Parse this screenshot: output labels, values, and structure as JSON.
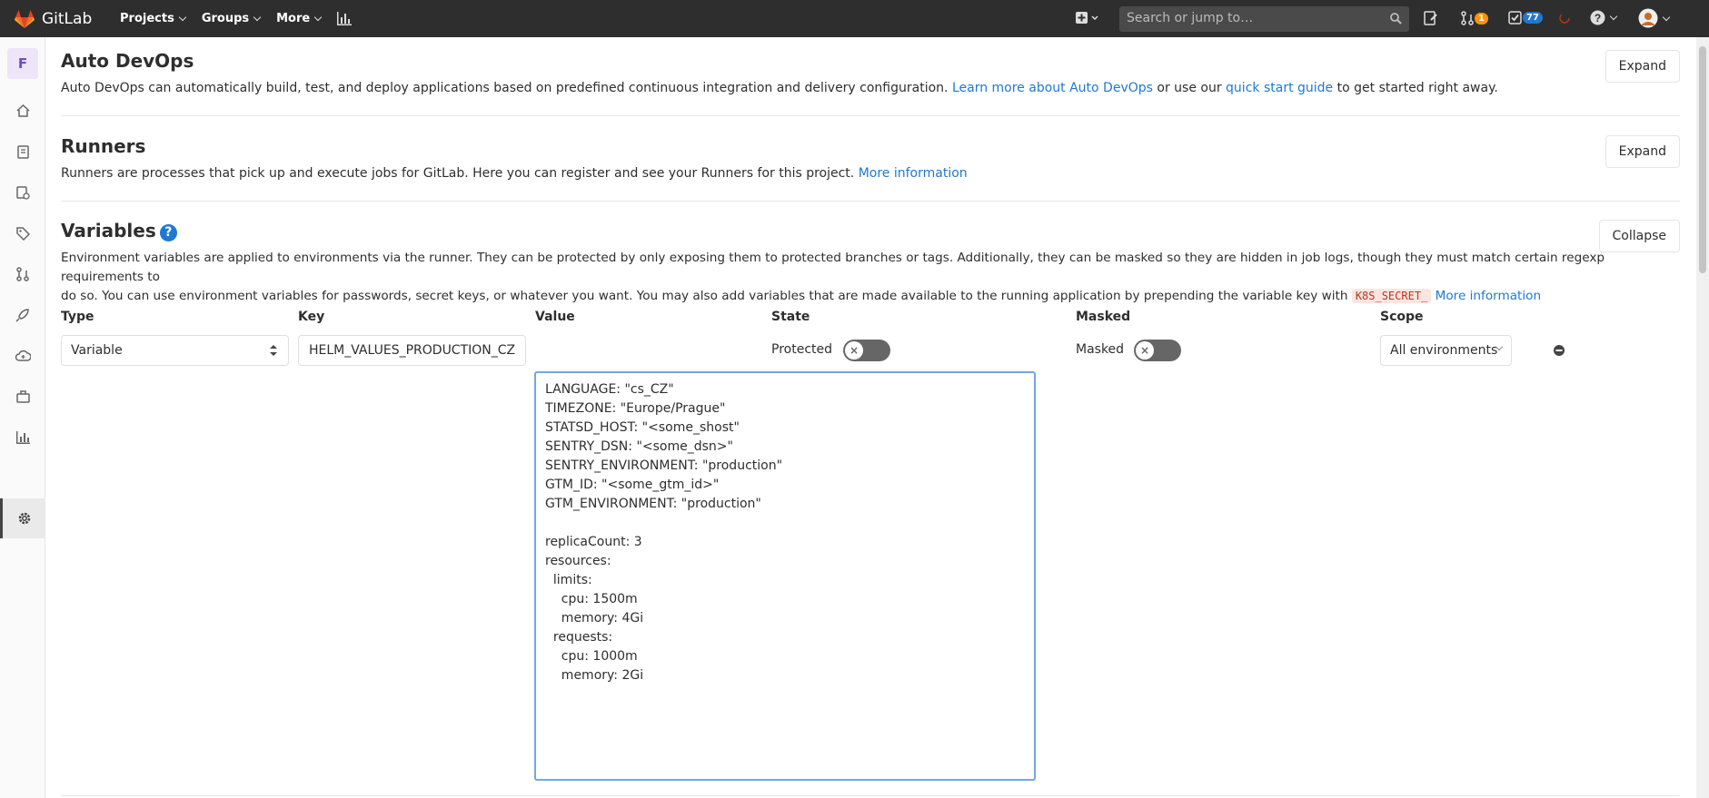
{
  "navbar": {
    "app_name": "GitLab",
    "menus": [
      {
        "label": "Projects"
      },
      {
        "label": "Groups"
      },
      {
        "label": "More"
      }
    ],
    "search_placeholder": "Search or jump to…",
    "merge_requests_count": "1",
    "todos_count": "77"
  },
  "sidebar": {
    "project_initial": "F",
    "items": [
      {
        "icon": "home-icon"
      },
      {
        "icon": "repository-icon"
      },
      {
        "icon": "issues-icon"
      },
      {
        "icon": "labels-icon"
      },
      {
        "icon": "merge-request-icon"
      },
      {
        "icon": "rocket-icon"
      },
      {
        "icon": "operations-icon"
      },
      {
        "icon": "packages-icon"
      },
      {
        "icon": "analytics-icon"
      },
      {
        "icon": "settings-icon"
      }
    ]
  },
  "auto_devops": {
    "title": "Auto DevOps",
    "desc": "Auto DevOps can automatically build, test, and deploy applications based on predefined continuous integration and delivery configuration.",
    "link1": "Learn more about Auto DevOps",
    "mid": "or use our",
    "link2": "quick start guide",
    "tail": "to get started right away.",
    "button": "Expand"
  },
  "runners": {
    "title": "Runners",
    "desc": "Runners are processes that pick up and execute jobs for GitLab. Here you can register and see your Runners for this project.",
    "link": "More information",
    "button": "Expand"
  },
  "variables": {
    "title": "Variables",
    "desc1": "Environment variables are applied to environments via the runner. They can be protected by only exposing them to protected branches or tags. Additionally, they can be masked so they are hidden in job logs, though they must match certain regexp requirements to",
    "desc2": "do so. You can use environment variables for passwords, secret keys, or whatever you want. You may also add variables that are made available to the running application by prepending the variable key with",
    "code": "K8S_SECRET_",
    "link": "More information",
    "button": "Collapse",
    "columns": {
      "type": "Type",
      "key": "Key",
      "value": "Value",
      "state": "State",
      "masked": "Masked",
      "scope": "Scope"
    },
    "row": {
      "type": "Variable",
      "key": "HELM_VALUES_PRODUCTION_CZ",
      "protected_label": "Protected",
      "masked_label": "Masked",
      "scope": "All environments",
      "value": "LANGUAGE: \"cs_CZ\"\nTIMEZONE: \"Europe/Prague\"\nSTATSD_HOST: \"<some_shost\"\nSENTRY_DSN: \"<some_dsn>\"\nSENTRY_ENVIRONMENT: \"production\"\nGTM_ID: \"<some_gtm_id>\"\nGTM_ENVIRONMENT: \"production\"\n\nreplicaCount: 3\nresources:\n  limits:\n    cpu: 1500m\n    memory: 4Gi\n  requests:\n    cpu: 1000m\n    memory: 2Gi\n"
    }
  }
}
